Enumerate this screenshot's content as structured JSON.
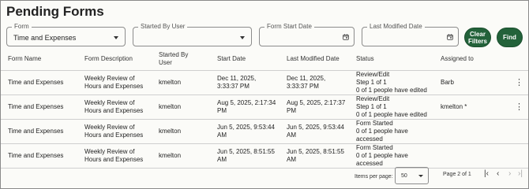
{
  "page": {
    "title": "Pending Forms"
  },
  "filters": {
    "form": {
      "legend": "Form",
      "value": "Time and Expenses"
    },
    "started_by": {
      "legend": "Started By User",
      "value": ""
    },
    "start_date": {
      "legend": "Form Start Date",
      "value": ""
    },
    "last_modified": {
      "legend": "Last Modified Date",
      "value": ""
    },
    "clear_label_1": "Clear",
    "clear_label_2": "Filters",
    "find_label": "Find"
  },
  "table": {
    "headers": {
      "form_name": "Form Name",
      "form_description": "Form Description",
      "started_by_1": "Started By",
      "started_by_2": "User",
      "start_date": "Start Date",
      "last_modified": "Last Modified Date",
      "status": "Status",
      "assigned_to": "Assigned to"
    },
    "rows": [
      {
        "form_name": "Time and Expenses",
        "desc_1": "Weekly Review of",
        "desc_2": "Hours and Expenses",
        "user": "kmelton",
        "start_1": "Dec 11, 2025,",
        "start_2": "3:33:37 PM",
        "mod_1": "Dec 11, 2025,",
        "mod_2": "3:33:37 PM",
        "status_1": "Review/Edit",
        "status_2": "Step 1 of 1",
        "status_3": "0 of 1 people have edited",
        "assigned": "Barb"
      },
      {
        "form_name": "Time and Expenses",
        "desc_1": "Weekly Review of",
        "desc_2": "Hours and Expenses",
        "user": "kmelton",
        "start_1": "Aug 5, 2025, 2:17:34",
        "start_2": "PM",
        "mod_1": "Aug 5, 2025, 2:17:37",
        "mod_2": "PM",
        "status_1": "Review/Edit",
        "status_2": "Step 1 of 1",
        "status_3": "0 of 1 people have edited",
        "assigned": "kmelton *"
      },
      {
        "form_name": "Time and Expenses",
        "desc_1": "Weekly Review of",
        "desc_2": "Hours and Expenses",
        "user": "kmelton",
        "start_1": "Jun 5, 2025, 9:53:44",
        "start_2": "AM",
        "mod_1": "Jun 5, 2025, 9:53:44",
        "mod_2": "AM",
        "status_1": "Form Started",
        "status_2": "0 of 1 people have",
        "status_3": "accessed",
        "assigned": ""
      },
      {
        "form_name": "Time and Expenses",
        "desc_1": "Weekly Review of",
        "desc_2": "Hours and Expenses",
        "user": "kmelton",
        "start_1": "Jun 5, 2025, 8:51:55",
        "start_2": "AM",
        "mod_1": "Jun 5, 2025, 8:51:55",
        "mod_2": "AM",
        "status_1": "Form Started",
        "status_2": "0 of 1 people have",
        "status_3": "accessed",
        "assigned": ""
      }
    ]
  },
  "pagination": {
    "items_per_page_label": "Items per page:",
    "items_per_page_value": "50",
    "page_label": "Page 2 of 1",
    "first_icon": "first-page-icon",
    "prev_icon": "chevron-left-icon",
    "next_icon": "chevron-right-icon",
    "last_icon": "last-page-icon"
  },
  "colors": {
    "accent": "#23623a",
    "background": "#fbfbf8"
  }
}
